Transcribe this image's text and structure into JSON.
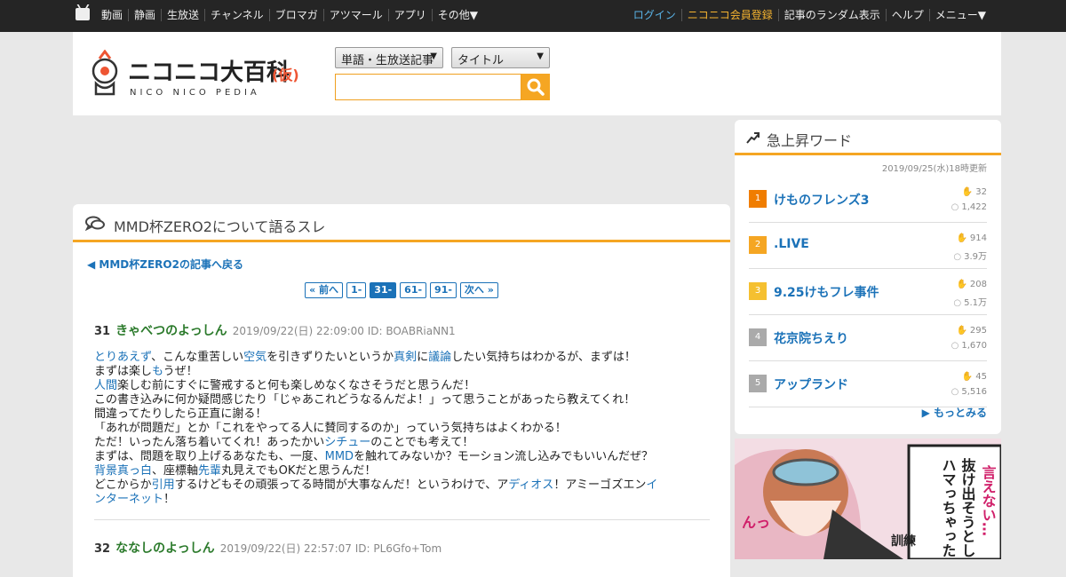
{
  "topnav": {
    "left": [
      "動画",
      "静画",
      "生放送",
      "チャンネル",
      "ブロマガ",
      "アツマール",
      "アプリ",
      "その他▼"
    ],
    "login": "ログイン",
    "register": "ニコニコ会員登録",
    "right": [
      "記事のランダム表示",
      "ヘルプ",
      "メニュー▼"
    ]
  },
  "header": {
    "logo_text": "ニコニコ大百科",
    "logo_suffix": "(仮)",
    "logo_sub": "NICO NICO PEDIA",
    "search_scope": "単語・生放送記事",
    "search_field": "タイトル",
    "search_value": ""
  },
  "thread": {
    "title": "MMD杯ZERO2について語るスレ",
    "back_link": "◀ MMD杯ZERO2の記事へ戻る",
    "pages": [
      "« 前へ",
      "1-",
      "31-",
      "61-",
      "91-",
      "次へ »"
    ],
    "current_page": "31-",
    "posts": [
      {
        "num": "31",
        "name": "きゃべつのよっしん",
        "meta": "2019/09/22(日) 22:09:00 ID: BOABRiaNN1",
        "lines": [
          [
            {
              "t": "とりあえず",
              "k": 1
            },
            {
              "t": "、こんな重苦しい"
            },
            {
              "t": "空気",
              "k": 1
            },
            {
              "t": "を引きずりたいというか"
            },
            {
              "t": "真剣",
              "k": 1
            },
            {
              "t": "に"
            },
            {
              "t": "議論",
              "k": 1
            },
            {
              "t": "したい気持ちはわかるが、まずは！"
            }
          ],
          [
            {
              "t": "まずは楽し"
            },
            {
              "t": "も",
              "k": 1
            },
            {
              "t": "うぜ！"
            }
          ],
          [
            {
              "t": "人間",
              "k": 1
            },
            {
              "t": "楽しむ前にすぐに警戒すると何も楽しめなくなさそうだと思うんだ！"
            }
          ],
          [
            {
              "t": "この書き込みに何か疑問感じたり「じゃあこれどうなるんだよ！」って思うことがあったら教えてくれ！"
            }
          ],
          [
            {
              "t": "間違ってたりしたら正直に謝る！"
            }
          ],
          [
            {
              "t": "「あれが問題だ」とか「これをやってる人に賛同するのか」っていう気持ちはよくわかる！"
            }
          ],
          [
            {
              "t": "ただ！いったん落ち着いてくれ！あったかい"
            },
            {
              "t": "シチュー",
              "k": 1
            },
            {
              "t": "のことでも考えて！"
            }
          ],
          [
            {
              "t": "まずは、問題を取り上げるあなたも、一度、"
            },
            {
              "t": "MMD",
              "k": 1
            },
            {
              "t": "を触れてみないか？モーション流し込みでもいいんだぜ？"
            }
          ],
          [
            {
              "t": "背景",
              "k": 1
            },
            {
              "t": "真っ白",
              "k": 1
            },
            {
              "t": "、座標軸"
            },
            {
              "t": "先輩",
              "k": 1
            },
            {
              "t": "丸見えでもOKだと思うんだ！"
            }
          ],
          [
            {
              "t": "どこからか"
            },
            {
              "t": "引用",
              "k": 1
            },
            {
              "t": "するけどもその頑張ってる時間が大事なんだ！というわけで、ア"
            },
            {
              "t": "ディオス",
              "k": 1
            },
            {
              "t": "！アミーゴズエン"
            },
            {
              "t": "イ",
              "k": 1
            }
          ],
          [
            {
              "t": "ンターネット",
              "k": 1
            },
            {
              "t": "！"
            }
          ]
        ]
      },
      {
        "num": "32",
        "name": "ななしのよっしん",
        "meta": "2019/09/22(日) 22:57:07 ID: PL6Gfo+Tom",
        "lines": []
      }
    ]
  },
  "sidebar": {
    "title": "急上昇ワード",
    "updated": "2019/09/25(水)18時更新",
    "items": [
      {
        "rank": "1",
        "word": "けものフレンズ3",
        "c1": "32",
        "c2": "1,422",
        "color": "#f07d00"
      },
      {
        "rank": "2",
        "word": ".LIVE",
        "c1": "914",
        "c2": "3.9万",
        "color": "#f5a623"
      },
      {
        "rank": "3",
        "word": "9.25けもフレ事件",
        "c1": "208",
        "c2": "5.1万",
        "color": "#f5c030"
      },
      {
        "rank": "4",
        "word": "花京院ちえり",
        "c1": "295",
        "c2": "1,670",
        "color": "#aaaaaa"
      },
      {
        "rank": "5",
        "word": "アップランド",
        "c1": "45",
        "c2": "5,516",
        "color": "#aaaaaa"
      }
    ],
    "more": "▶ もっとみる"
  },
  "ad": {
    "lines": [
      "言えない…",
      "抜け出そうとし",
      "ハマっちゃったな"
    ],
    "side_text": "んっ",
    "caption": "訓練"
  },
  "colors": {
    "accent": "#f5a623",
    "link": "#1b72b8",
    "name": "#2b7a2b",
    "topbar": "#252525"
  }
}
